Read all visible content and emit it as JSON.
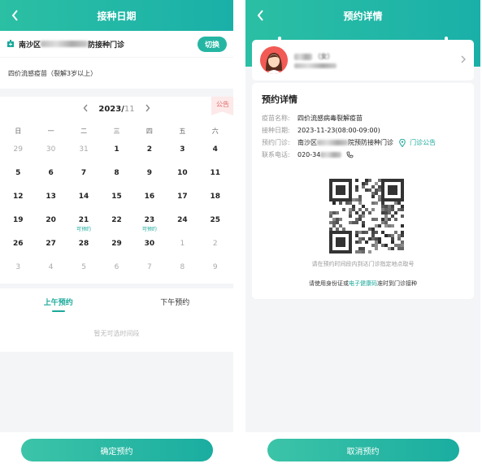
{
  "left": {
    "header": {
      "title": "接种日期"
    },
    "clinic": {
      "prefix": "南沙区",
      "suffix": "防接种门诊",
      "switch_label": "切换"
    },
    "vaccine": {
      "label": "四价流感疫苗（裂解3岁以上）"
    },
    "notice_tag": "公告",
    "calendar": {
      "year": "2023/",
      "month": "11",
      "weekdays": [
        "日",
        "一",
        "二",
        "三",
        "四",
        "五",
        "六"
      ],
      "days": [
        {
          "d": "29",
          "m": true
        },
        {
          "d": "30",
          "m": true
        },
        {
          "d": "31",
          "m": true
        },
        {
          "d": "1"
        },
        {
          "d": "2"
        },
        {
          "d": "3"
        },
        {
          "d": "4"
        },
        {
          "d": "5"
        },
        {
          "d": "6"
        },
        {
          "d": "7"
        },
        {
          "d": "8"
        },
        {
          "d": "9"
        },
        {
          "d": "10"
        },
        {
          "d": "11"
        },
        {
          "d": "12"
        },
        {
          "d": "13"
        },
        {
          "d": "14"
        },
        {
          "d": "15"
        },
        {
          "d": "16"
        },
        {
          "d": "17"
        },
        {
          "d": "18"
        },
        {
          "d": "19"
        },
        {
          "d": "20"
        },
        {
          "d": "21",
          "s": "可预约"
        },
        {
          "d": "22"
        },
        {
          "d": "23",
          "s": "可预约"
        },
        {
          "d": "24"
        },
        {
          "d": "25"
        },
        {
          "d": "26"
        },
        {
          "d": "27"
        },
        {
          "d": "28"
        },
        {
          "d": "29"
        },
        {
          "d": "30"
        },
        {
          "d": "1",
          "m": true
        },
        {
          "d": "2",
          "m": true
        },
        {
          "d": "3",
          "m": true
        },
        {
          "d": "4",
          "m": true
        },
        {
          "d": "5",
          "m": true
        },
        {
          "d": "6",
          "m": true
        },
        {
          "d": "7",
          "m": true
        },
        {
          "d": "8",
          "m": true
        },
        {
          "d": "9",
          "m": true
        }
      ]
    },
    "tabs": {
      "morning": "上午预约",
      "afternoon": "下午预约"
    },
    "empty_text": "暂无可选时间段",
    "confirm_label": "确定预约"
  },
  "right": {
    "header": {
      "title": "预约详情"
    },
    "user": {
      "name_suffix": "（女）"
    },
    "detail": {
      "title": "预约详情",
      "vaccine_label": "疫苗名称:",
      "vaccine_value": "四价流感病毒裂解疫苗",
      "date_label": "接种日期:",
      "date_value": "2023-11-23(08:00-09:00)",
      "clinic_label": "预约门诊:",
      "clinic_prefix": "南沙区",
      "clinic_suffix": "院预防接种门诊",
      "clinic_notice": "门诊公告",
      "phone_label": "联系电话:",
      "phone_prefix": "020-34"
    },
    "hint_top": "请在预约时间段内到达门诊指定地点取号",
    "hint_bottom_pre": "请使用身份证或",
    "hint_bottom_link": "电子健康码",
    "hint_bottom_post": "准时到门诊接种",
    "cancel_label": "取消预约"
  }
}
